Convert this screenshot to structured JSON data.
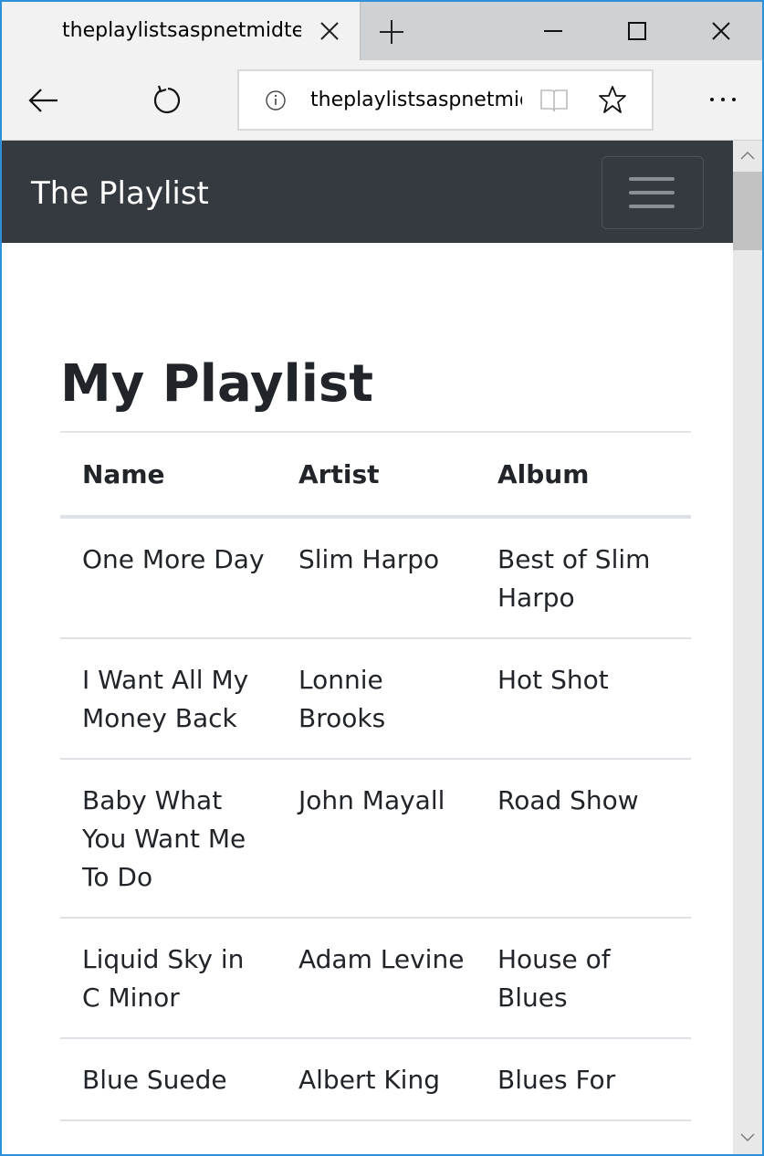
{
  "browser": {
    "tab_title": "theplaylistsaspnetmidterm",
    "address": "theplaylistsaspnetmidterm.azurewebsites.net"
  },
  "site": {
    "brand": "The Playlist"
  },
  "page": {
    "title": "My Playlist"
  },
  "table": {
    "headers": [
      "Name",
      "Artist",
      "Album"
    ],
    "rows": [
      [
        "One More Day",
        "Slim Harpo",
        "Best of Slim Harpo"
      ],
      [
        "I Want All My Money Back",
        "Lonnie Brooks",
        "Hot Shot"
      ],
      [
        "Baby What You Want Me To Do",
        "John Mayall",
        "Road Show"
      ],
      [
        "Liquid Sky in C Minor",
        "Adam Levine",
        "House of Blues"
      ],
      [
        "Blue Suede",
        "Albert King",
        "Blues For"
      ]
    ]
  },
  "icons": {
    "tab_close": "close-icon",
    "new_tab": "plus-icon",
    "minimize": "minimize-icon",
    "maximize": "maximize-icon",
    "close": "close-icon",
    "back": "back-arrow-icon",
    "refresh": "refresh-icon",
    "info": "info-icon",
    "reader": "reading-view-icon",
    "favorite": "star-icon",
    "more": "more-icon",
    "menu": "hamburger-icon"
  },
  "colors": {
    "navbar_bg": "#343a40",
    "window_border": "#2f8fd8",
    "text": "#212529"
  }
}
